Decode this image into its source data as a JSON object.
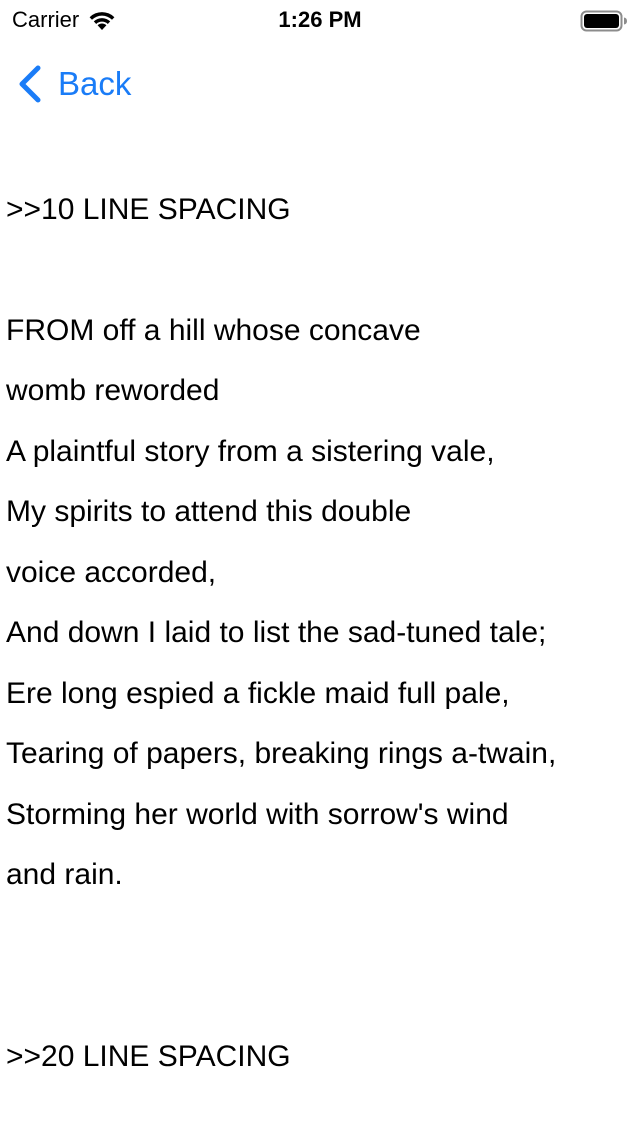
{
  "status_bar": {
    "carrier": "Carrier",
    "time": "1:26 PM",
    "wifi_icon": "wifi-icon",
    "battery_icon": "battery-full-icon"
  },
  "nav": {
    "back_label": "Back",
    "back_icon": "chevron-left-icon",
    "accent_color": "#1a7cf7"
  },
  "content": {
    "heading_10": ">>10 LINE SPACING",
    "poem": [
      "FROM off a hill whose concave",
      "womb reworded",
      "A plaintful story from a sistering vale,",
      "My spirits to attend this double",
      "voice accorded,",
      "And down I laid to list the sad-tuned tale;",
      "Ere long espied a fickle maid full pale,",
      "Tearing of papers, breaking rings a-twain,",
      "Storming her world with sorrow's wind",
      "and rain."
    ],
    "heading_20": ">>20 LINE SPACING"
  }
}
